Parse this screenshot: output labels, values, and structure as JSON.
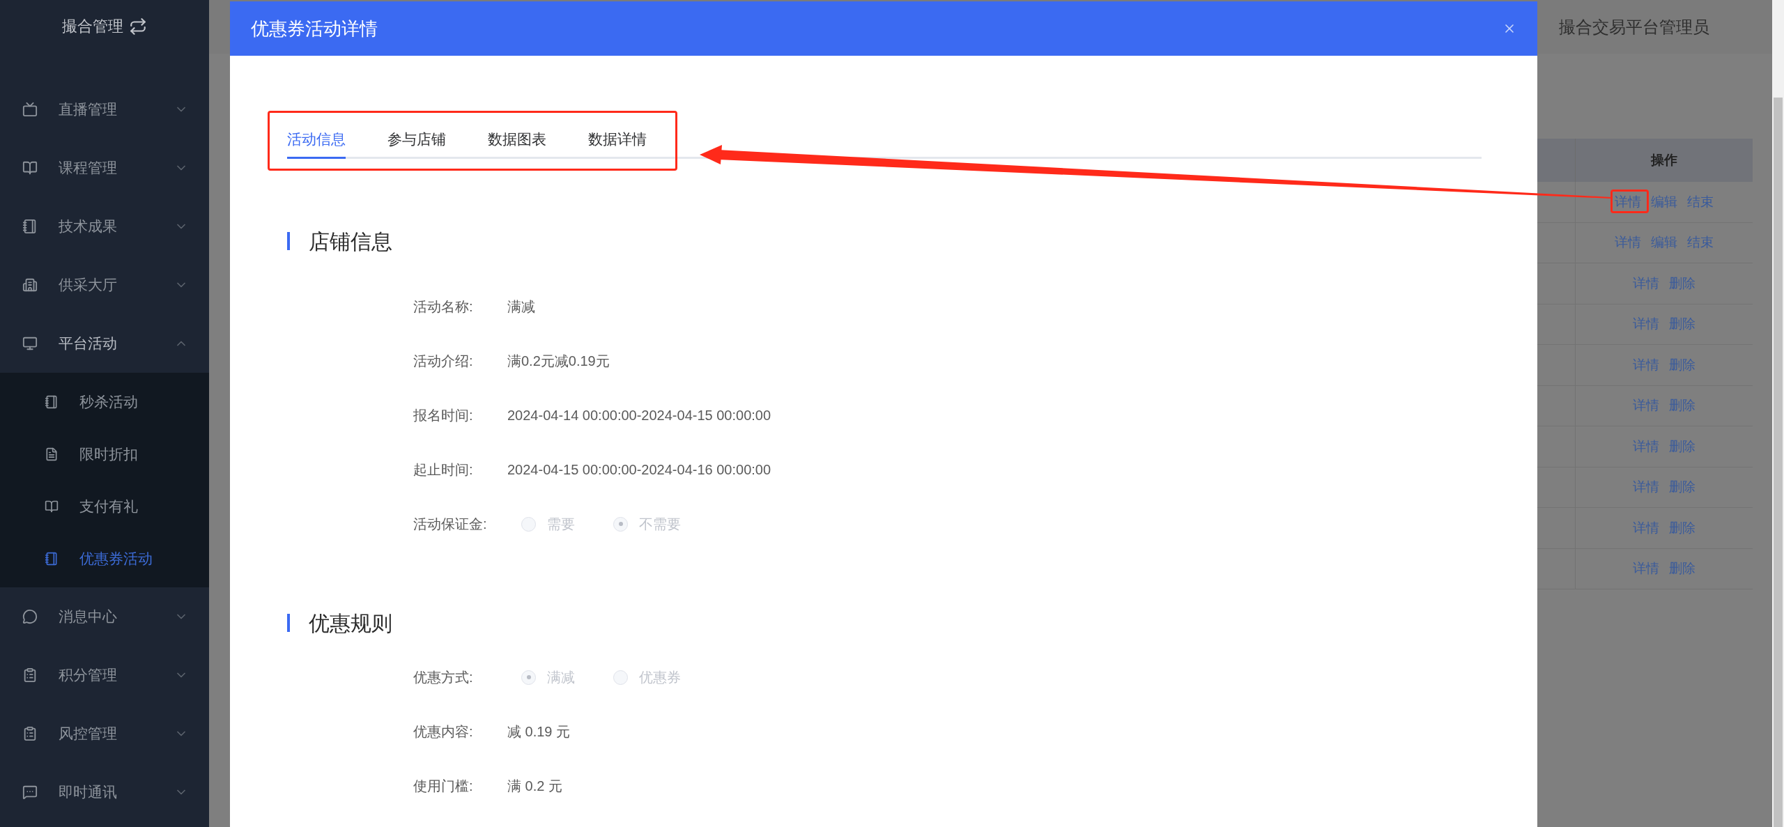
{
  "sidebar": {
    "title": "撮合管理",
    "items": [
      {
        "label": "直播管理",
        "expanded": false
      },
      {
        "label": "课程管理",
        "expanded": false
      },
      {
        "label": "技术成果",
        "expanded": false
      },
      {
        "label": "供采大厅",
        "expanded": false
      },
      {
        "label": "平台活动",
        "expanded": true,
        "children": [
          {
            "label": "秒杀活动",
            "selected": false
          },
          {
            "label": "限时折扣",
            "selected": false
          },
          {
            "label": "支付有礼",
            "selected": false
          },
          {
            "label": "优惠券活动",
            "selected": true
          }
        ]
      },
      {
        "label": "消息中心",
        "expanded": false
      },
      {
        "label": "积分管理",
        "expanded": false
      },
      {
        "label": "风控管理",
        "expanded": false
      },
      {
        "label": "即时通讯",
        "expanded": false
      }
    ]
  },
  "header": {
    "user_name": "撮合交易平台管理员"
  },
  "table": {
    "columns": [
      "操作"
    ],
    "rows": [
      {
        "actions": [
          "详情",
          "编辑",
          "结束"
        ]
      },
      {
        "actions": [
          "详情",
          "编辑",
          "结束"
        ]
      },
      {
        "actions": [
          "详情",
          "删除"
        ]
      },
      {
        "actions": [
          "详情",
          "删除"
        ]
      },
      {
        "actions": [
          "详情",
          "删除"
        ]
      },
      {
        "actions": [
          "详情",
          "删除"
        ]
      },
      {
        "actions": [
          "详情",
          "删除"
        ]
      },
      {
        "actions": [
          "详情",
          "删除"
        ]
      },
      {
        "actions": [
          "详情",
          "删除"
        ]
      },
      {
        "actions": [
          "详情",
          "删除"
        ]
      }
    ]
  },
  "dialog": {
    "title": "优惠券活动详情",
    "tabs": [
      {
        "label": "活动信息",
        "selected": true
      },
      {
        "label": "参与店铺",
        "selected": false
      },
      {
        "label": "数据图表",
        "selected": false
      },
      {
        "label": "数据详情",
        "selected": false
      }
    ],
    "sections": [
      {
        "title": "店铺信息",
        "fields": [
          {
            "kind": "text",
            "label": "活动名称:",
            "value": "满减"
          },
          {
            "kind": "text",
            "label": "活动介绍:",
            "value": "满0.2元减0.19元"
          },
          {
            "kind": "text",
            "label": "报名时间:",
            "value": "2024-04-14 00:00:00-2024-04-15 00:00:00"
          },
          {
            "kind": "text",
            "label": "起止时间:",
            "value": "2024-04-15 00:00:00-2024-04-16 00:00:00"
          },
          {
            "kind": "radio",
            "label": "活动保证金:",
            "options": [
              {
                "label": "需要",
                "selected": false
              },
              {
                "label": "不需要",
                "selected": true
              }
            ]
          }
        ]
      },
      {
        "title": "优惠规则",
        "fields": [
          {
            "kind": "radio",
            "label": "优惠方式:",
            "options": [
              {
                "label": "满减",
                "selected": true
              },
              {
                "label": "优惠券",
                "selected": false
              }
            ]
          },
          {
            "kind": "text",
            "label": "优惠内容:",
            "value": "减 0.19 元"
          },
          {
            "kind": "text",
            "label": "使用门槛:",
            "value": "满 0.2 元"
          }
        ]
      }
    ]
  }
}
